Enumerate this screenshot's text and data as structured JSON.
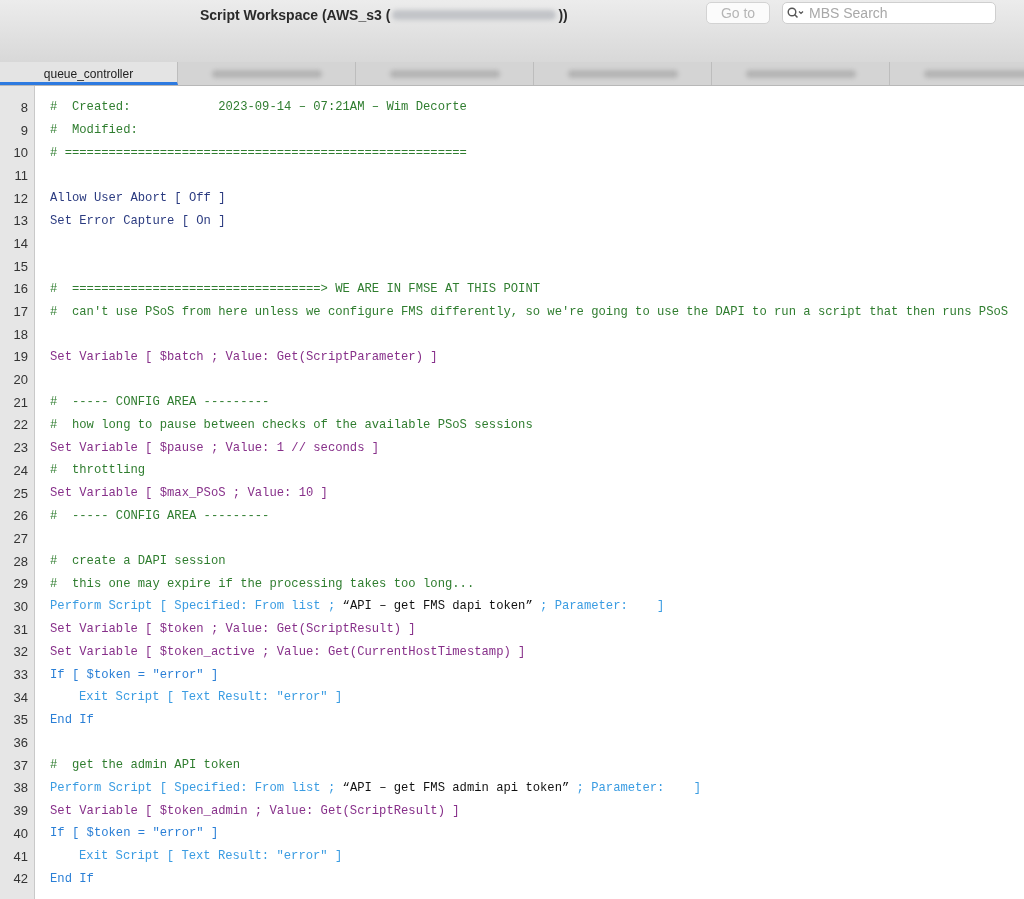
{
  "window": {
    "title": "Script Workspace (AWS_s3 (",
    "title_end": "))"
  },
  "toolbar": {
    "goto_button": "Go to",
    "search": {
      "placeholder": "MBS Search"
    }
  },
  "tabs": [
    {
      "label": "queue_controller",
      "selected": true
    },
    {
      "selected": false
    },
    {
      "selected": false
    },
    {
      "selected": false
    },
    {
      "selected": false
    },
    {
      "selected": false
    }
  ],
  "script": {
    "lines": [
      {
        "number": "8",
        "segments": [
          {
            "kind": "comment",
            "text": "#  Created:            2023-09-14 – 07:21AM – Wim Decorte"
          }
        ]
      },
      {
        "number": "9",
        "segments": [
          {
            "kind": "comment",
            "text": "#  Modified:"
          }
        ]
      },
      {
        "number": "10",
        "segments": [
          {
            "kind": "comment",
            "text": "# ======================================================="
          }
        ]
      },
      {
        "number": "11"
      },
      {
        "number": "12",
        "segments": [
          {
            "kind": "step",
            "text": "Allow User Abort [ Off ]"
          }
        ]
      },
      {
        "number": "13",
        "segments": [
          {
            "kind": "step",
            "text": "Set Error Capture [ On ]"
          }
        ]
      },
      {
        "number": "14"
      },
      {
        "number": "15"
      },
      {
        "number": "16",
        "segments": [
          {
            "kind": "comment",
            "text": "#  ==================================> WE ARE IN FMSE AT THIS POINT"
          }
        ]
      },
      {
        "number": "17",
        "segments": [
          {
            "kind": "comment",
            "text": "#  can't use PSoS from here unless we configure FMS differently, so we're going to use the DAPI to run a script that then runs PSoS"
          }
        ]
      },
      {
        "number": "18"
      },
      {
        "number": "19",
        "segments": [
          {
            "kind": "variable",
            "text": "Set Variable [ $batch ; Value: Get(ScriptParameter) ]"
          }
        ]
      },
      {
        "number": "20"
      },
      {
        "number": "21",
        "segments": [
          {
            "kind": "comment",
            "text": "#  ----- CONFIG AREA ---------"
          }
        ]
      },
      {
        "number": "22",
        "segments": [
          {
            "kind": "comment",
            "text": "#  how long to pause between checks of the available PSoS sessions"
          }
        ]
      },
      {
        "number": "23",
        "segments": [
          {
            "kind": "variable",
            "text": "Set Variable [ $pause ; Value: 1 // seconds ]"
          }
        ]
      },
      {
        "number": "24",
        "segments": [
          {
            "kind": "comment",
            "text": "#  throttling"
          }
        ]
      },
      {
        "number": "25",
        "segments": [
          {
            "kind": "variable",
            "text": "Set Variable [ $max_PSoS ; Value: 10 ]"
          }
        ]
      },
      {
        "number": "26",
        "segments": [
          {
            "kind": "comment",
            "text": "#  ----- CONFIG AREA ---------"
          }
        ]
      },
      {
        "number": "27"
      },
      {
        "number": "28",
        "segments": [
          {
            "kind": "comment",
            "text": "#  create a DAPI session"
          }
        ]
      },
      {
        "number": "29",
        "segments": [
          {
            "kind": "comment",
            "text": "#  this one may expire if the processing takes too long..."
          }
        ]
      },
      {
        "number": "30",
        "segments": [
          {
            "kind": "script",
            "text": "Perform Script [ Specified: From list ; "
          },
          {
            "kind": "literal",
            "text": "“API – get FMS dapi token”"
          },
          {
            "kind": "script",
            "text": " ; Parameter:    ]"
          }
        ]
      },
      {
        "number": "31",
        "segments": [
          {
            "kind": "variable",
            "text": "Set Variable [ $token ; Value: Get(ScriptResult) ]"
          }
        ]
      },
      {
        "number": "32",
        "segments": [
          {
            "kind": "variable",
            "text": "Set Variable [ $token_active ; Value: Get(CurrentHostTimestamp) ]"
          }
        ]
      },
      {
        "number": "33",
        "segments": [
          {
            "kind": "control",
            "text": "If [ $token = \"error\" ]"
          }
        ],
        "children": [
          {
            "number": "34",
            "segments": [
              {
                "kind": "script",
                "text": "Exit Script [ Text Result: \"error\" ]"
              }
            ]
          }
        ]
      },
      {
        "number": "35",
        "segments": [
          {
            "kind": "control",
            "text": "End If"
          }
        ]
      },
      {
        "number": "36"
      },
      {
        "number": "37",
        "segments": [
          {
            "kind": "comment",
            "text": "#  get the admin API token"
          }
        ]
      },
      {
        "number": "38",
        "segments": [
          {
            "kind": "script",
            "text": "Perform Script [ Specified: From list ; "
          },
          {
            "kind": "literal",
            "text": "“API – get FMS admin api token”"
          },
          {
            "kind": "script",
            "text": " ; Parameter:    ]"
          }
        ]
      },
      {
        "number": "39",
        "segments": [
          {
            "kind": "variable",
            "text": "Set Variable [ $token_admin ; Value: Get(ScriptResult) ]"
          }
        ]
      },
      {
        "number": "40",
        "segments": [
          {
            "kind": "control",
            "text": "If [ $token = \"error\" ]"
          }
        ],
        "children": [
          {
            "number": "41",
            "segments": [
              {
                "kind": "script",
                "text": "Exit Script [ Text Result: \"error\" ]"
              }
            ]
          }
        ]
      },
      {
        "number": "42",
        "segments": [
          {
            "kind": "control",
            "text": "End If"
          }
        ]
      }
    ]
  }
}
